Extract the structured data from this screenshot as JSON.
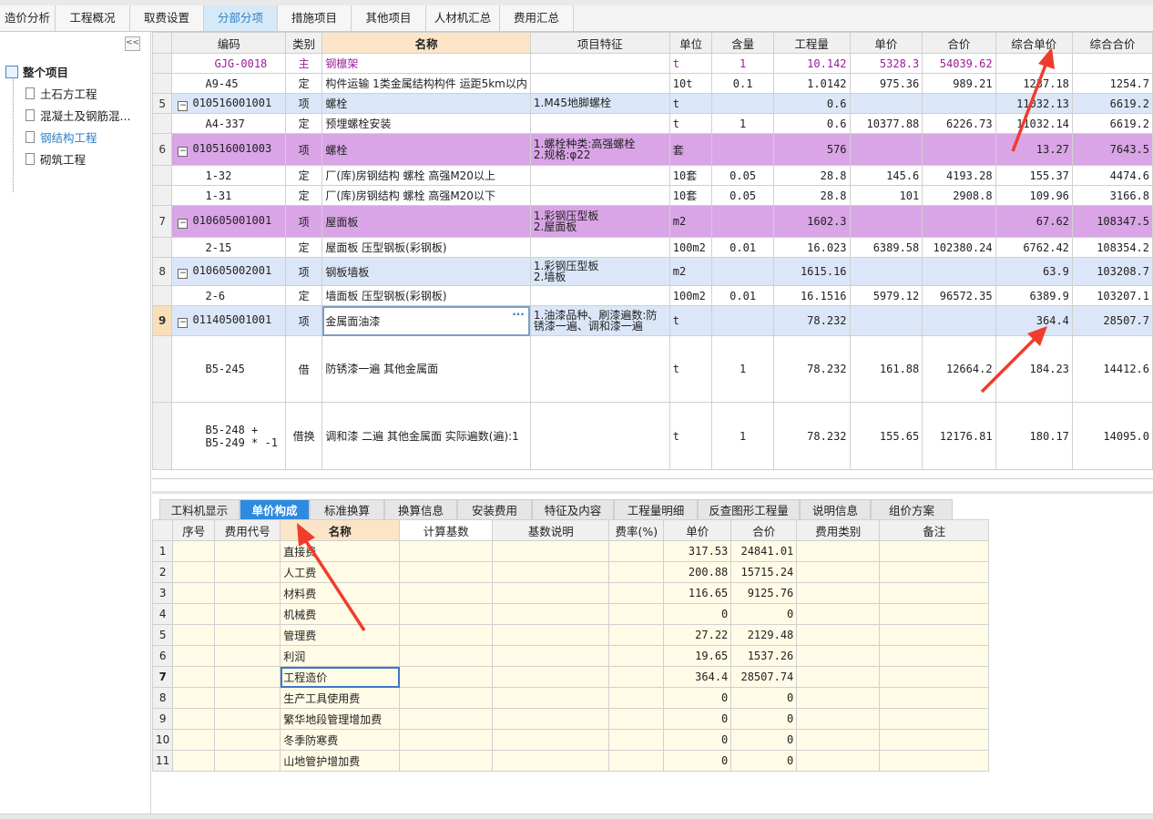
{
  "top_tabs": [
    "造价分析",
    "工程概况",
    "取费设置",
    "分部分项",
    "措施项目",
    "其他项目",
    "人材机汇总",
    "费用汇总"
  ],
  "active_top_tab": 3,
  "tree": {
    "collapse_label": "<<",
    "root": "整个项目",
    "items": [
      "土石方工程",
      "混凝土及钢筋混...",
      "钢结构工程",
      "砌筑工程"
    ],
    "active_item": 2
  },
  "main_grid": {
    "headers": [
      "编码",
      "类别",
      "名称",
      "项目特征",
      "单位",
      "含量",
      "工程量",
      "单价",
      "合价",
      "综合单价",
      "综合合价"
    ],
    "rows": [
      {
        "num": "",
        "code": "GJG-0018",
        "type": "主",
        "name": "钢檩架",
        "feature": "",
        "unit": "t",
        "qty_ratio": "1",
        "quantity": "10.142",
        "price": "5328.3",
        "total": "54039.62",
        "comp_price": "",
        "comp_total": "",
        "style": "sub-purple",
        "level": 2
      },
      {
        "num": "",
        "code": "A9-45",
        "type": "定",
        "name": "构件运输 1类金属结构构件 运距5km以内",
        "feature": "",
        "unit": "10t",
        "qty_ratio": "0.1",
        "quantity": "1.0142",
        "price": "975.36",
        "total": "989.21",
        "comp_price": "1237.18",
        "comp_total": "1254.7",
        "style": "sub",
        "level": 1
      },
      {
        "num": "5",
        "code": "010516001001",
        "type": "项",
        "name": "螺栓",
        "feature": "1.M45地脚螺栓",
        "unit": "t",
        "qty_ratio": "",
        "quantity": "0.6",
        "price": "",
        "total": "",
        "comp_price": "11032.13",
        "comp_total": "6619.2",
        "style": "item-blue",
        "level": 0
      },
      {
        "num": "",
        "code": "A4-337",
        "type": "定",
        "name": "预埋螺栓安装",
        "feature": "",
        "unit": "t",
        "qty_ratio": "1",
        "quantity": "0.6",
        "price": "10377.88",
        "total": "6226.73",
        "comp_price": "11032.14",
        "comp_total": "6619.2",
        "style": "sub",
        "level": 1
      },
      {
        "num": "6",
        "code": "010516001003",
        "type": "项",
        "name": "螺栓",
        "feature": "1.螺栓种类:高强螺栓\n2.规格:φ22",
        "unit": "套",
        "qty_ratio": "",
        "quantity": "576",
        "price": "",
        "total": "",
        "comp_price": "13.27",
        "comp_total": "7643.5",
        "style": "item-purple",
        "level": 0
      },
      {
        "num": "",
        "code": "1-32",
        "type": "定",
        "name": "厂(库)房钢结构 螺栓 高强M20以上",
        "feature": "",
        "unit": "10套",
        "qty_ratio": "0.05",
        "quantity": "28.8",
        "price": "145.6",
        "total": "4193.28",
        "comp_price": "155.37",
        "comp_total": "4474.6",
        "style": "sub",
        "level": 1
      },
      {
        "num": "",
        "code": "1-31",
        "type": "定",
        "name": "厂(库)房钢结构 螺栓 高强M20以下",
        "feature": "",
        "unit": "10套",
        "qty_ratio": "0.05",
        "quantity": "28.8",
        "price": "101",
        "total": "2908.8",
        "comp_price": "109.96",
        "comp_total": "3166.8",
        "style": "sub",
        "level": 1
      },
      {
        "num": "7",
        "code": "010605001001",
        "type": "项",
        "name": "屋面板",
        "feature": "1.彩钢压型板\n2.屋面板",
        "unit": "m2",
        "qty_ratio": "",
        "quantity": "1602.3",
        "price": "",
        "total": "",
        "comp_price": "67.62",
        "comp_total": "108347.5",
        "style": "item-purple",
        "level": 0
      },
      {
        "num": "",
        "code": "2-15",
        "type": "定",
        "name": "屋面板 压型钢板(彩钢板)",
        "feature": "",
        "unit": "100m2",
        "qty_ratio": "0.01",
        "quantity": "16.023",
        "price": "6389.58",
        "total": "102380.24",
        "comp_price": "6762.42",
        "comp_total": "108354.2",
        "style": "sub",
        "level": 1
      },
      {
        "num": "8",
        "code": "010605002001",
        "type": "项",
        "name": "钢板墙板",
        "feature": "1.彩钢压型板\n2.墙板",
        "unit": "m2",
        "qty_ratio": "",
        "quantity": "1615.16",
        "price": "",
        "total": "",
        "comp_price": "63.9",
        "comp_total": "103208.7",
        "style": "item-blue",
        "level": 0
      },
      {
        "num": "",
        "code": "2-6",
        "type": "定",
        "name": "墙面板 压型钢板(彩钢板)",
        "feature": "",
        "unit": "100m2",
        "qty_ratio": "0.01",
        "quantity": "16.1516",
        "price": "5979.12",
        "total": "96572.35",
        "comp_price": "6389.9",
        "comp_total": "103207.1",
        "style": "sub",
        "level": 1
      },
      {
        "num": "9",
        "code": "011405001001",
        "type": "项",
        "name": "金属面油漆",
        "feature": "1.油漆品种、刷漆遍数:防锈漆一遍、调和漆一遍",
        "unit": "t",
        "qty_ratio": "",
        "quantity": "78.232",
        "price": "",
        "total": "",
        "comp_price": "364.4",
        "comp_total": "28507.7",
        "style": "item-blue-selected",
        "level": 0
      },
      {
        "num": "",
        "code": "B5-245",
        "type": "借",
        "name": "防锈漆一遍 其他金属面",
        "feature": "",
        "unit": "t",
        "qty_ratio": "1",
        "quantity": "78.232",
        "price": "161.88",
        "total": "12664.2",
        "comp_price": "184.23",
        "comp_total": "14412.6",
        "style": "sub-tall",
        "level": 1
      },
      {
        "num": "",
        "code": "B5-248 +\nB5-249 * -1",
        "type": "借换",
        "name": "调和漆 二遍 其他金属面  实际遍数(遍):1",
        "feature": "",
        "unit": "t",
        "qty_ratio": "1",
        "quantity": "78.232",
        "price": "155.65",
        "total": "12176.81",
        "comp_price": "180.17",
        "comp_total": "14095.0",
        "style": "sub-tall",
        "level": 1
      }
    ]
  },
  "bottom_tabs": [
    "工料机显示",
    "单价构成",
    "标准换算",
    "换算信息",
    "安装费用",
    "特征及内容",
    "工程量明细",
    "反查图形工程量",
    "说明信息",
    "组价方案"
  ],
  "active_bottom_tab": 1,
  "sub_grid": {
    "headers": [
      "序号",
      "费用代号",
      "名称",
      "计算基数",
      "基数说明",
      "费率(%)",
      "单价",
      "合价",
      "费用类别",
      "备注"
    ],
    "rows": [
      {
        "num": "1",
        "name": "直接费",
        "price": "317.53",
        "total": "24841.01"
      },
      {
        "num": "2",
        "name": "人工费",
        "price": "200.88",
        "total": "15715.24"
      },
      {
        "num": "3",
        "name": "材料费",
        "price": "116.65",
        "total": "9125.76"
      },
      {
        "num": "4",
        "name": "机械费",
        "price": "0",
        "total": "0"
      },
      {
        "num": "5",
        "name": "管理费",
        "price": "27.22",
        "total": "2129.48"
      },
      {
        "num": "6",
        "name": "利润",
        "price": "19.65",
        "total": "1537.26"
      },
      {
        "num": "7",
        "name": "工程造价",
        "price": "364.4",
        "total": "28507.74"
      },
      {
        "num": "8",
        "name": "生产工具使用费",
        "price": "0",
        "total": "0"
      },
      {
        "num": "9",
        "name": "繁华地段管理增加费",
        "price": "0",
        "total": "0"
      },
      {
        "num": "10",
        "name": "冬季防寒费",
        "price": "0",
        "total": "0"
      },
      {
        "num": "11",
        "name": "山地管护增加费",
        "price": "0",
        "total": "0"
      }
    ],
    "selected_row": 6
  },
  "colors": {
    "accent": "#2d8be0",
    "item_blue": "#dbe7f8",
    "item_purple": "#d9a5e6",
    "arrow": "#f03c2e"
  }
}
